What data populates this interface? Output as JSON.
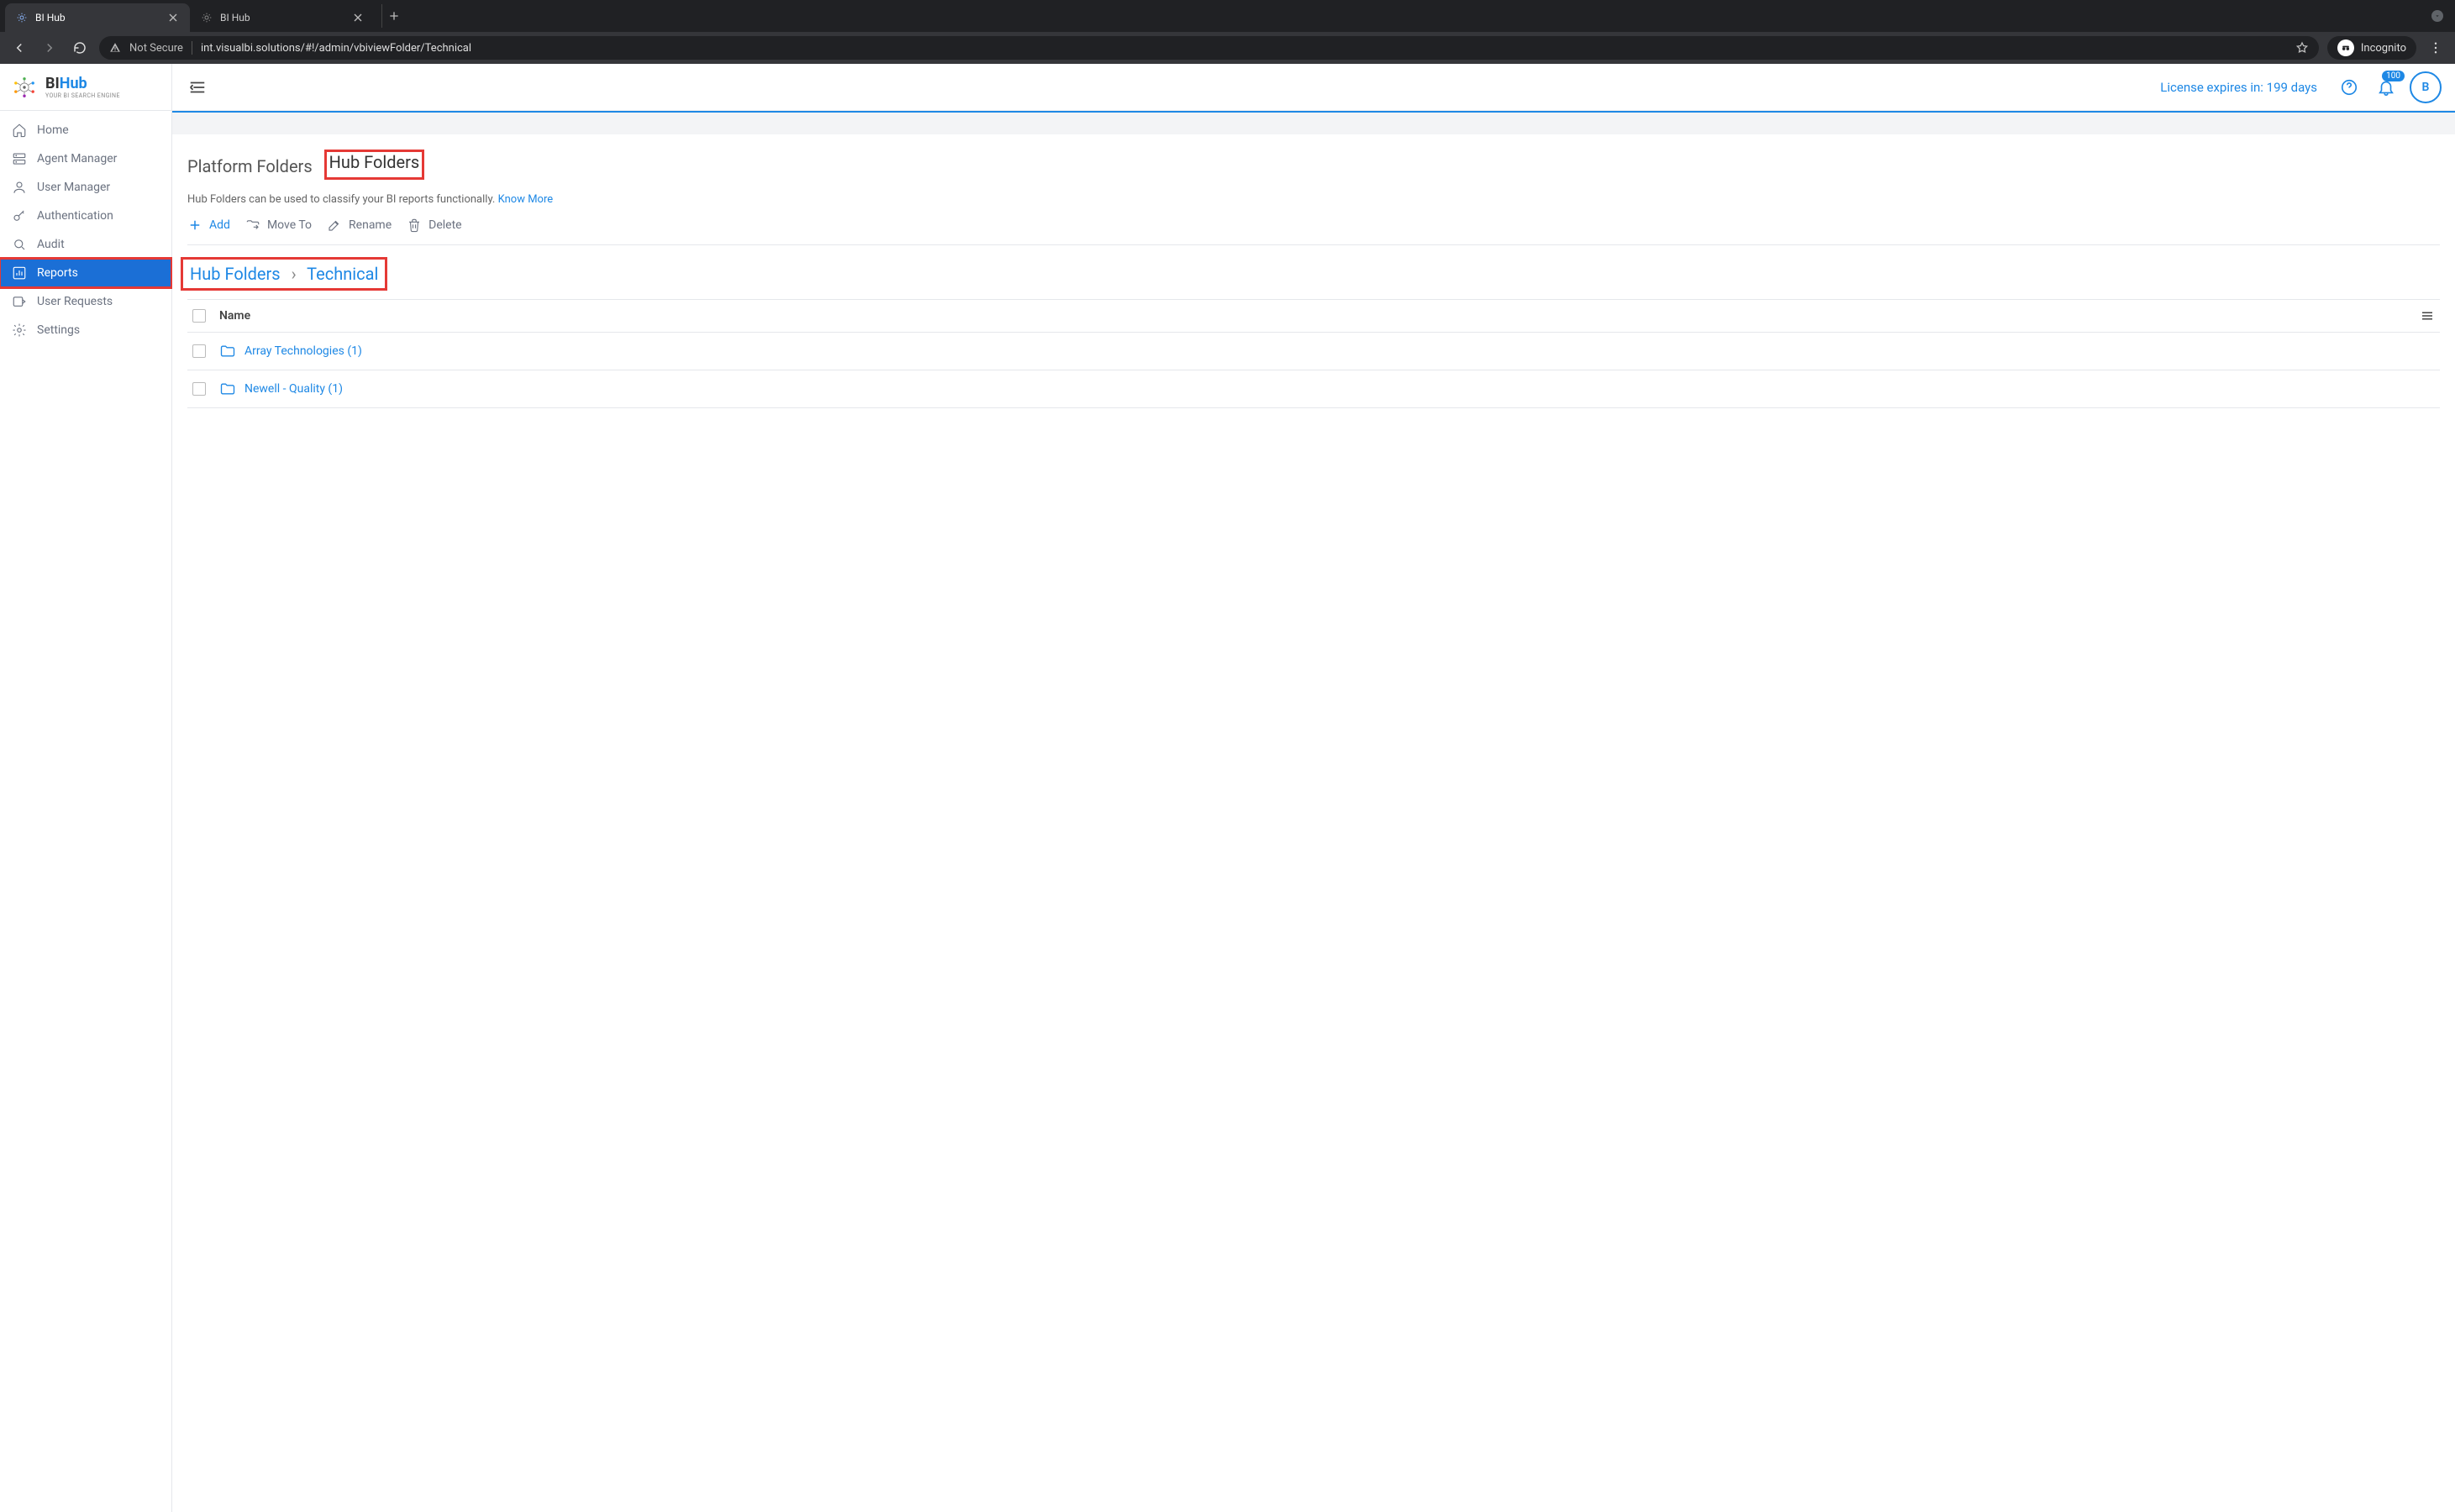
{
  "browser": {
    "tabs": [
      {
        "title": "BI Hub",
        "active": true
      },
      {
        "title": "BI Hub",
        "active": false
      }
    ],
    "not_secure": "Not Secure",
    "url": "int.visualbi.solutions/#!/admin/vbiviewFolder/Technical",
    "incognito_label": "Incognito"
  },
  "logo": {
    "bi": "BI",
    "hub": "Hub",
    "tagline": "YOUR BI SEARCH ENGINE"
  },
  "sidebar": {
    "items": [
      {
        "label": "Home",
        "icon": "home"
      },
      {
        "label": "Agent Manager",
        "icon": "server"
      },
      {
        "label": "User Manager",
        "icon": "user"
      },
      {
        "label": "Authentication",
        "icon": "key"
      },
      {
        "label": "Audit",
        "icon": "search"
      },
      {
        "label": "Reports",
        "icon": "chart",
        "active": true,
        "highlighted": true
      },
      {
        "label": "User Requests",
        "icon": "inbox"
      },
      {
        "label": "Settings",
        "icon": "gear"
      }
    ]
  },
  "header": {
    "license": "License expires in: 199 days",
    "notif_count": "100",
    "avatar_letter": "B"
  },
  "tabs": {
    "platform": "Platform Folders",
    "hub": "Hub Folders"
  },
  "subtitle": {
    "text": "Hub Folders can be used to classify your BI reports functionally. ",
    "link": "Know More"
  },
  "toolbar": {
    "add": "Add",
    "moveto": "Move To",
    "rename": "Rename",
    "delete": "Delete"
  },
  "breadcrumb": {
    "root": "Hub Folders",
    "sep": "›",
    "current": "Technical"
  },
  "table": {
    "header_name": "Name",
    "rows": [
      {
        "name": "Array Technologies (1)"
      },
      {
        "name": "Newell - Quality (1)"
      }
    ]
  }
}
